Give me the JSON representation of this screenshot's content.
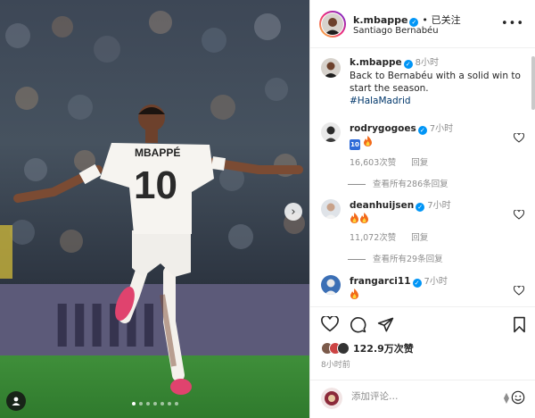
{
  "post": {
    "author": "k.mbappe",
    "separator": "•",
    "follow_status": "已关注",
    "location": "Santiago Bernabéu",
    "media": {
      "jersey_name": "MBAPPÉ",
      "jersey_number": "10",
      "carousel_dots": 7,
      "active_dot": 0
    }
  },
  "caption": {
    "author": "k.mbappe",
    "time": "8小时",
    "text": "Back to Bernabéu with a solid win to start the season.",
    "hashtag": "#HalaMadrid"
  },
  "comments": [
    {
      "author": "rodrygogoes",
      "time": "7小时",
      "text_badge": "10",
      "likes": "16,603次赞",
      "reply_label": "回复",
      "view_replies": "查看所有286条回复"
    },
    {
      "author": "deanhuijsen",
      "time": "7小时",
      "likes": "11,072次赞",
      "reply_label": "回复",
      "view_replies": "查看所有29条回复"
    },
    {
      "author": "frangarci11",
      "time": "7小时"
    }
  ],
  "actions": {
    "like_count": "122.9万次赞",
    "posted_ago": "8小时前"
  },
  "composer": {
    "placeholder": "添加评论…"
  },
  "colors": {
    "verified": "#0095f6",
    "hashtag": "#00376b",
    "muted": "#8e8e8e"
  }
}
